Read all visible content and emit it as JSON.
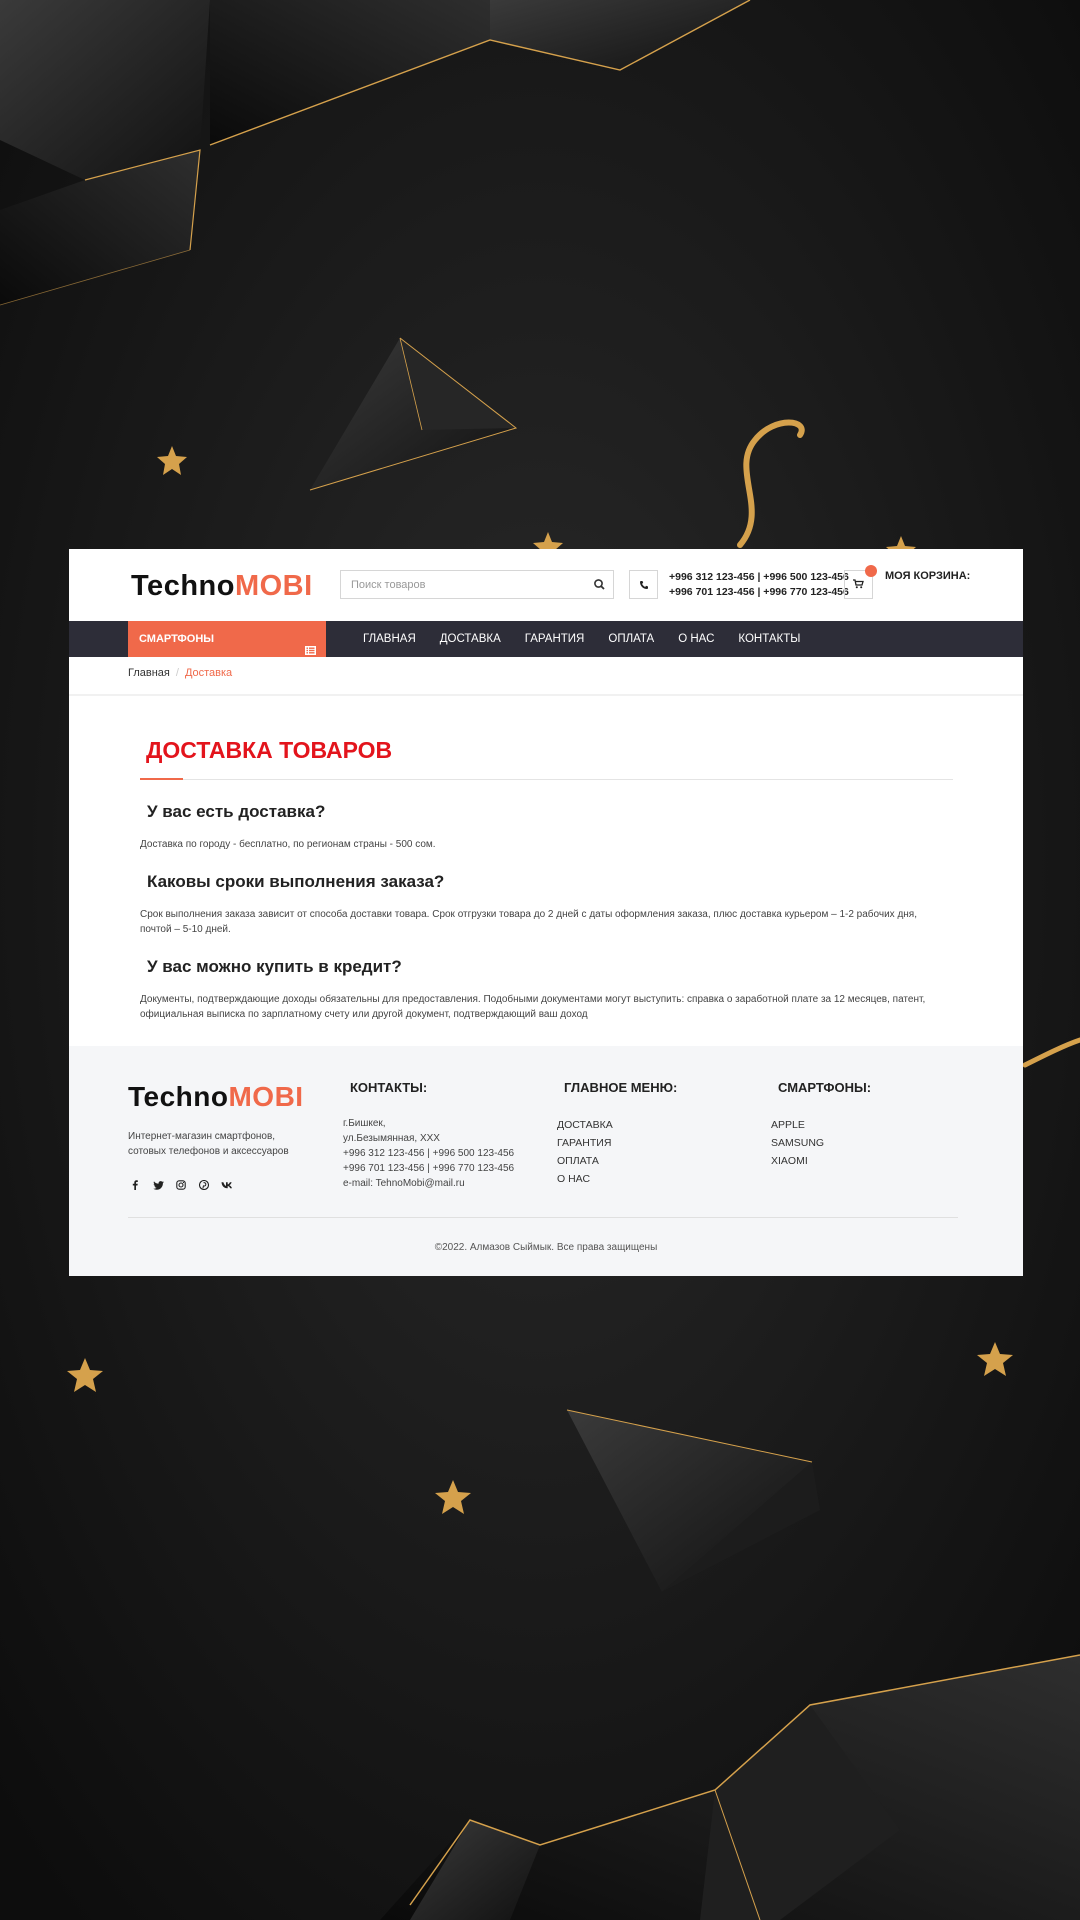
{
  "colors": {
    "accent": "#f0694a",
    "title_red": "#e3141c",
    "nav_bg": "#2d2d38",
    "footer_bg": "#f5f6f8",
    "background": "#161616",
    "gold": "#d5a14c"
  },
  "header": {
    "logo": {
      "part1": "Techno",
      "part2": "MOBI"
    },
    "search": {
      "placeholder": "Поиск товаров",
      "icon": "search-icon"
    },
    "phone_icon": "phone-icon",
    "phones": [
      "+996 312 123-456 | +996 500 123-456",
      "+996 701 123-456 | +996 770 123-456"
    ],
    "cart": {
      "icon": "cart-icon",
      "label": "МОЯ КОРЗИНА:"
    }
  },
  "nav": {
    "category_button": "СМАРТФОНЫ",
    "links": [
      "ГЛАВНАЯ",
      "ДОСТАВКА",
      "ГАРАНТИЯ",
      "ОПЛАТА",
      "О НАС",
      "КОНТАКТЫ"
    ]
  },
  "breadcrumb": {
    "home": "Главная",
    "separator": "/",
    "current": "Доставка"
  },
  "content": {
    "title": "ДОСТАВКА ТОВАРОВ",
    "faq": [
      {
        "q": "У вас есть доставка?",
        "a": "Доставка по городу - бесплатно, по регионам страны - 500 сом."
      },
      {
        "q": "Каковы сроки выполнения заказа?",
        "a": "Срок выполнения заказа зависит от способа доставки товара. Срок отгрузки товара до 2 дней с даты оформления заказа, плюс доставка курьером – 1-2 рабочих дня, почтой – 5-10 дней."
      },
      {
        "q": "У вас можно купить в кредит?",
        "a": "Документы, подтверждающие доходы обязательны для предоставления. Подобными документами могут выступить: справка о заработной плате за 12 месяцев, патент, официальная выписка по зарплатному счету или другой документ, подтверждающий ваш доход"
      }
    ]
  },
  "footer": {
    "logo": {
      "part1": "Techno",
      "part2": "MOBI"
    },
    "about_lines": [
      "Интернет-магазин смартфонов,",
      "сотовых телефонов и аксессуаров"
    ],
    "socials": [
      "facebook-icon",
      "twitter-icon",
      "instagram-icon",
      "pinterest-icon",
      "vk-icon"
    ],
    "contacts": {
      "title": "КОНТАКТЫ:",
      "lines": [
        "г.Бишкек,",
        "ул.Безымянная, XXX",
        "+996 312 123-456 | +996 500 123-456",
        "+996 701 123-456 | +996 770 123-456",
        "e-mail: TehnoMobi@mail.ru"
      ]
    },
    "main_menu": {
      "title": "ГЛАВНОЕ МЕНЮ:",
      "items": [
        "ДОСТАВКА",
        "ГАРАНТИЯ",
        "ОПЛАТА",
        "О НАС"
      ]
    },
    "smartphones": {
      "title": "СМАРТФОНЫ:",
      "items": [
        "APPLE",
        "SAMSUNG",
        "XIAOMI"
      ]
    },
    "copyright": "©2022. Алмазов Сыймык. Все права защищены"
  }
}
